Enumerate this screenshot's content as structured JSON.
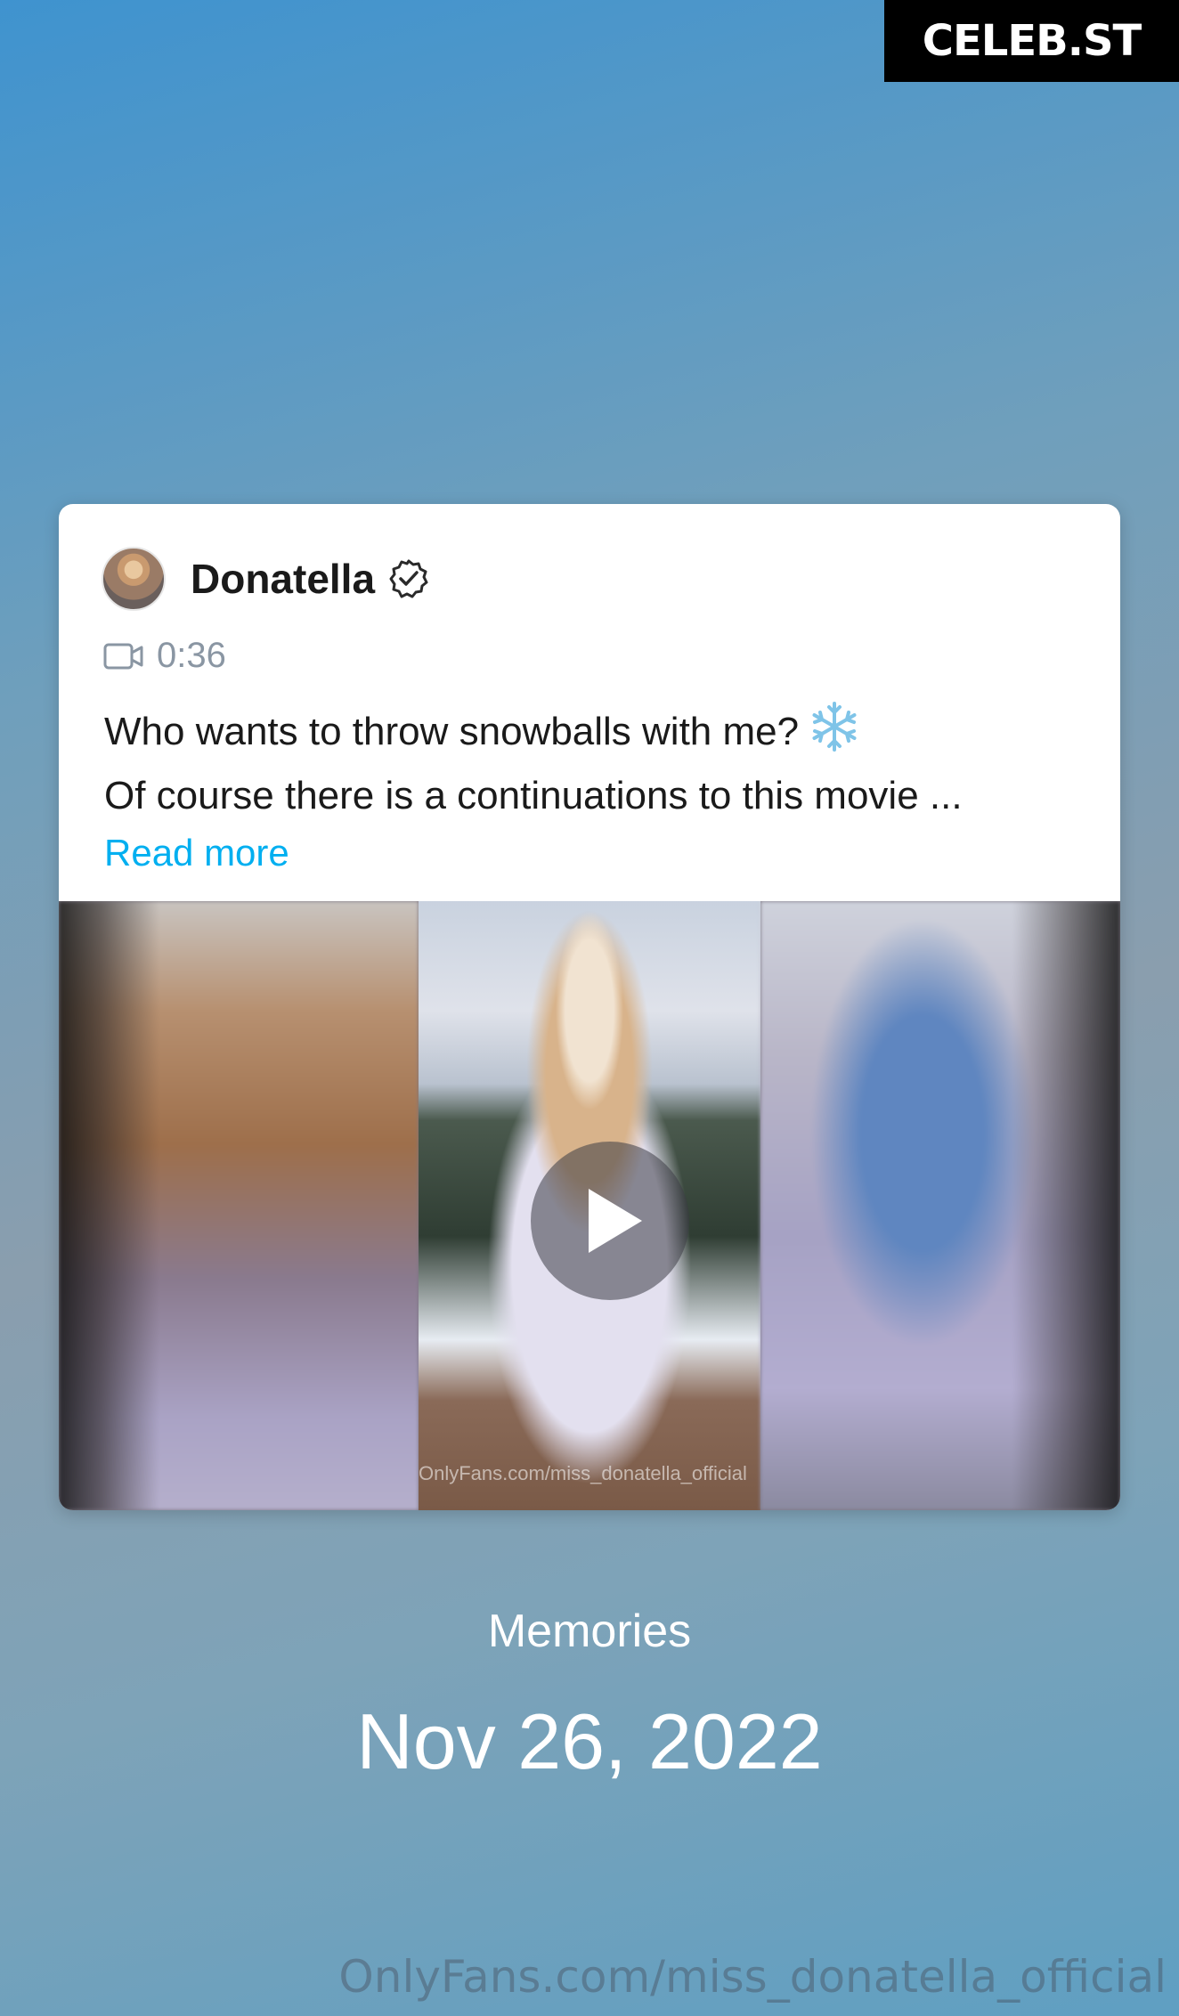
{
  "brand": {
    "badge": "CELEB.ST"
  },
  "post": {
    "author": "Donatella",
    "verified": true,
    "duration": "0:36",
    "text_line_1": "Who wants to throw snowballs with me?",
    "text_line_2": "Of course there is a continuations to this movie ...",
    "read_more": "Read more",
    "media_watermark": "OnlyFans.com/miss_donatella_official",
    "icons": {
      "video": "video-camera-icon",
      "verified": "verified-badge-icon",
      "snowflake": "snowflake-icon",
      "play": "play-icon"
    }
  },
  "memories": {
    "label": "Memories",
    "date": "Nov 26, 2022"
  },
  "footer": {
    "watermark": "OnlyFans.com/miss_donatella_official"
  },
  "colors": {
    "link": "#00aff0",
    "text": "#1a1a1a",
    "muted": "#8a96a3"
  }
}
